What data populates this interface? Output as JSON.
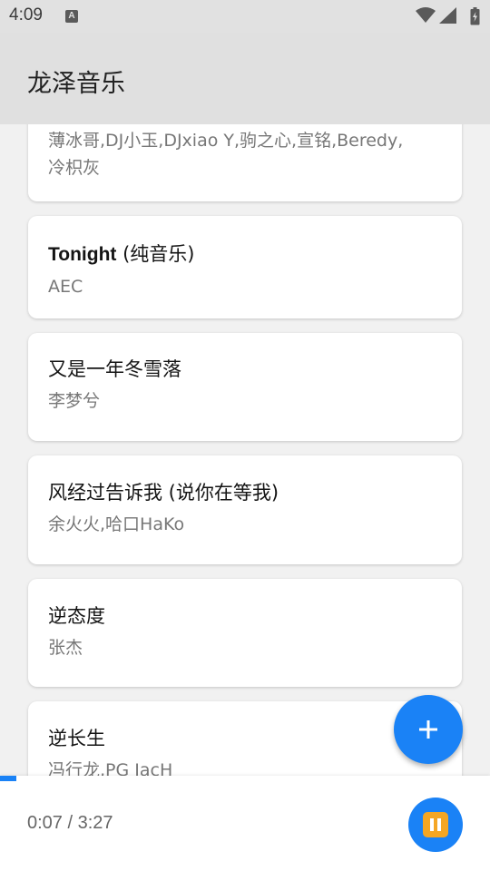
{
  "status_bar": {
    "time": "4:09",
    "notification_icon": "A",
    "icons": [
      "wifi-icon",
      "signal-icon",
      "battery-icon"
    ]
  },
  "app_bar": {
    "title": "龙泽音乐"
  },
  "songs": [
    {
      "title": "",
      "artist": "薄冰哥,DJ小玉,DJxiao Y,驹之心,宣铭,Beredy,",
      "artist_line2": "冷枳灰"
    },
    {
      "title_en": "Tonight",
      "title": " (纯音乐)",
      "artist": "AEC"
    },
    {
      "title": "又是一年冬雪落",
      "artist": "李梦兮"
    },
    {
      "title": "风经过告诉我 (说你在等我)",
      "artist": "余火火,哈口HaKo"
    },
    {
      "title": "逆态度",
      "artist": "张杰"
    },
    {
      "title": "逆长生",
      "artist": "冯行龙,PG JacH"
    }
  ],
  "fab": {
    "icon": "plus-icon"
  },
  "player": {
    "time": "0:07 / 3:27",
    "progress_fraction": 0.034,
    "pause_icon": "pause-icon"
  },
  "colors": {
    "accent": "#1a82f6",
    "pause_icon_bg": "#f5a623",
    "app_bar": "#e0e0e0",
    "background": "#f1f1f1"
  }
}
